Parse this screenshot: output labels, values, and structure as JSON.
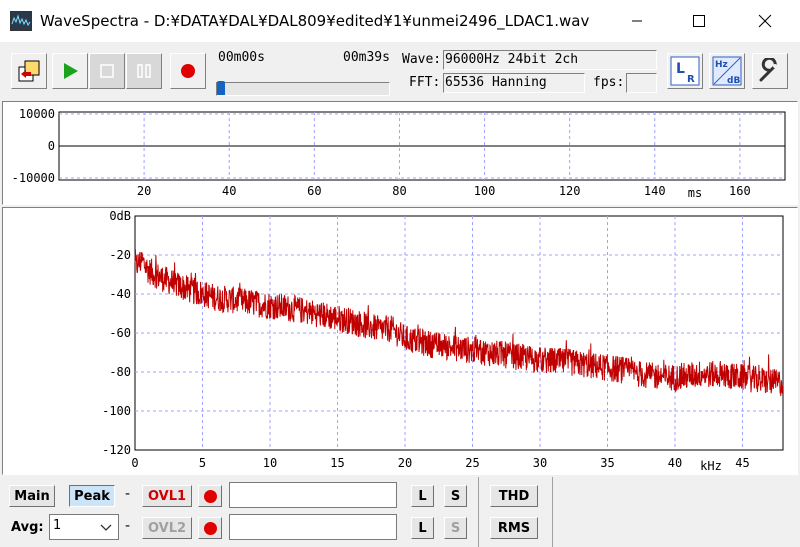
{
  "window": {
    "title": "WaveSpectra - D:¥DATA¥DAL¥DAL809¥edited¥1¥unmei2496_LDAC1.wav",
    "minimize": "—",
    "maximize": "☐",
    "close": "✕"
  },
  "toolbar": {
    "time_start": "00m00s",
    "time_end": "00m39s",
    "wave_label": "Wave:",
    "wave_value": "96000Hz 24bit 2ch",
    "fft_label": "FFT:",
    "fft_value": "65536 Hanning",
    "fps_label": "fps:",
    "fps_value": "",
    "lr_icon_text": "L",
    "lr_icon_sub": "R",
    "hzdb_top": "Hz",
    "hzdb_bottom": "dB",
    "position_fraction": 0.0
  },
  "waveform": {
    "y_ticks": [
      "10000",
      "0",
      "-10000"
    ],
    "x_ticks": [
      "20",
      "40",
      "60",
      "80",
      "100",
      "120",
      "140",
      "160"
    ],
    "x_unit": "ms"
  },
  "spectrum": {
    "y_ticks": [
      "0dB",
      "-20",
      "-40",
      "-60",
      "-80",
      "-100",
      "-120"
    ],
    "x_ticks": [
      "0",
      "5",
      "10",
      "15",
      "20",
      "25",
      "30",
      "35",
      "40",
      "45"
    ],
    "x_unit": "kHz",
    "line_color": "#c00000"
  },
  "controls": {
    "main_label": "Main",
    "peak_label": "Peak",
    "dash1": "-",
    "dash2": "-",
    "ovl1_label": "OVL1",
    "ovl2_label": "OVL2",
    "avg_label": "Avg:",
    "avg_value": "1",
    "l_label": "L",
    "s_label": "S",
    "thd_label": "THD",
    "rms_label": "RMS",
    "ovl1_text": "",
    "ovl2_text": ""
  },
  "chart_data": {
    "type": "line",
    "xlabel": "kHz",
    "ylabel": "",
    "xlim": [
      0,
      48
    ],
    "ylim": [
      -120,
      0
    ],
    "grid": true,
    "series": [
      {
        "x": [
          0,
          0.5,
          1,
          2,
          3,
          4,
          5,
          6,
          8,
          10,
          12,
          14,
          16,
          18,
          19,
          20,
          22,
          24,
          26,
          28,
          30,
          32,
          34,
          36,
          38,
          40,
          42,
          44,
          46,
          48
        ],
        "values": [
          -28,
          -25,
          -30,
          -34,
          -37,
          -40,
          -42,
          -44,
          -46,
          -48,
          -50,
          -53,
          -56,
          -60,
          -60,
          -65,
          -68,
          -70,
          -72,
          -74,
          -76,
          -77,
          -79,
          -81,
          -84,
          -85,
          -83,
          -84,
          -86,
          -88
        ]
      }
    ]
  }
}
